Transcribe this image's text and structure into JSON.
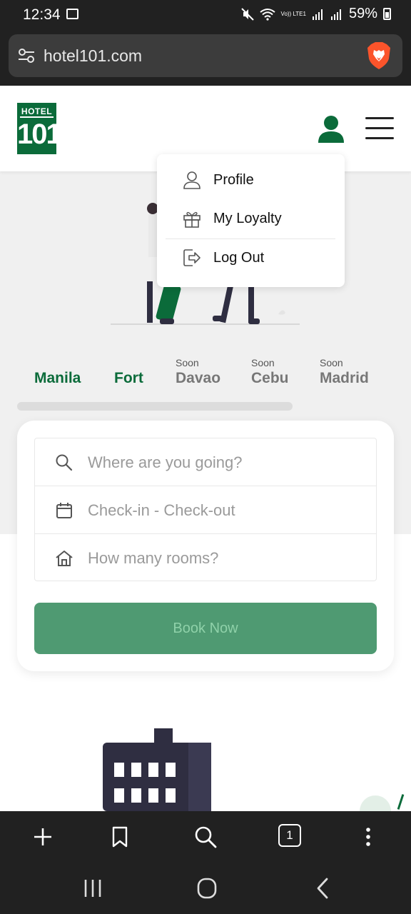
{
  "status_bar": {
    "time": "12:34",
    "battery": "59%",
    "icons": [
      "gallery-icon",
      "mute-icon",
      "wifi-icon",
      "volte-icon",
      "signal-icon",
      "battery-icon"
    ],
    "volte_label": "Vo)) LTE1"
  },
  "browser": {
    "url": "hotel101.com",
    "icons": [
      "tune-icon",
      "brave-lion-icon"
    ]
  },
  "header": {
    "logo_top": "HOTEL",
    "logo_main": "101",
    "brand_color": "#0b6b3a"
  },
  "user_menu": {
    "items": [
      {
        "label": "Profile",
        "icon": "person-icon"
      },
      {
        "label": "My Loyalty",
        "icon": "gift-icon"
      },
      {
        "label": "Log Out",
        "icon": "logout-icon"
      }
    ]
  },
  "locations": [
    {
      "name": "Manila",
      "soon": "",
      "active": true
    },
    {
      "name": "Fort",
      "soon": "",
      "active": true
    },
    {
      "name": "Davao",
      "soon": "Soon",
      "active": false
    },
    {
      "name": "Cebu",
      "soon": "Soon",
      "active": false
    },
    {
      "name": "Madrid",
      "soon": "Soon",
      "active": false
    }
  ],
  "booking": {
    "destination_placeholder": "Where are you going?",
    "dates_placeholder": "Check-in - Check-out",
    "rooms_placeholder": "How many rooms?",
    "book_label": "Book Now",
    "button_color": "#4f9a72"
  },
  "toolbar": {
    "tab_count": "1",
    "icons": [
      "plus-icon",
      "bookmark-icon",
      "search-icon",
      "tabs-icon",
      "more-icon"
    ]
  },
  "navbar": {
    "icons": [
      "recents-icon",
      "home-icon",
      "back-icon"
    ]
  }
}
